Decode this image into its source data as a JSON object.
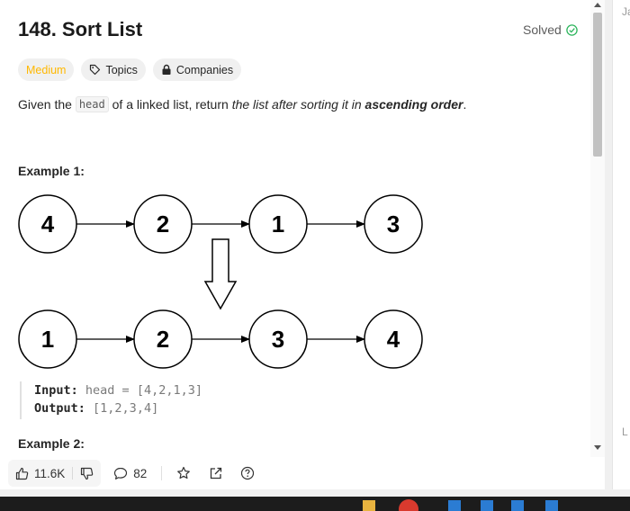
{
  "problem": {
    "title": "148. Sort List",
    "status": "Solved",
    "difficulty": "Medium",
    "topics_label": "Topics",
    "companies_label": "Companies"
  },
  "description": {
    "p1": "Given the ",
    "code": "head",
    "p2": " of a linked list, return ",
    "em": "the list after sorting it in ",
    "strong": "ascending order",
    "end": "."
  },
  "example1": {
    "heading": "Example 1:",
    "input_list": [
      "4",
      "2",
      "1",
      "3"
    ],
    "output_list": [
      "1",
      "2",
      "3",
      "4"
    ],
    "input_label": "Input:",
    "input_value": "head = [4,2,1,3]",
    "output_label": "Output:",
    "output_value": "[1,2,3,4]"
  },
  "example2": {
    "heading": "Example 2:"
  },
  "footer": {
    "likes": "11.6K",
    "comments": "82"
  },
  "right_pane": {
    "top_text": "Ja",
    "bottom_text": "L"
  },
  "colors": {
    "medium": "#ffb800",
    "solved_check": "#2db55d"
  }
}
